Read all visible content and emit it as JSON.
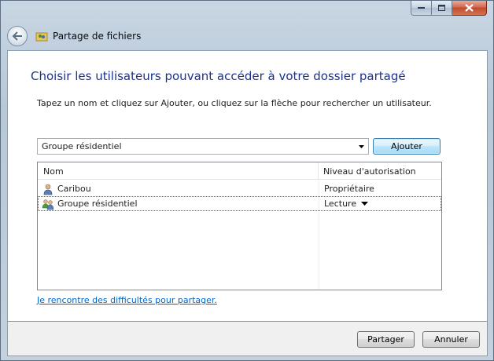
{
  "window": {
    "title": "Partage de fichiers"
  },
  "content": {
    "heading": "Choisir les utilisateurs pouvant accéder à votre dossier partagé",
    "instruction": "Tapez un nom et cliquez sur Ajouter, ou cliquez sur la flèche pour rechercher un utilisateur.",
    "combo_value": "Groupe résidentiel",
    "add_button": "Ajouter"
  },
  "list": {
    "columns": [
      "Nom",
      "Niveau d'autorisation"
    ],
    "rows": [
      {
        "name": "Caribou",
        "level": "Propriétaire",
        "icon": "user-icon"
      },
      {
        "name": "Groupe résidentiel",
        "level": "Lecture",
        "icon": "homegroup-icon",
        "selected": true
      }
    ]
  },
  "help_link": "Je rencontre des difficultés pour partager.",
  "footer": {
    "share_button": "Partager",
    "cancel_button": "Annuler"
  },
  "colors": {
    "heading": "#1e3287",
    "link": "#0066cc",
    "close_button": "#c14a30"
  }
}
